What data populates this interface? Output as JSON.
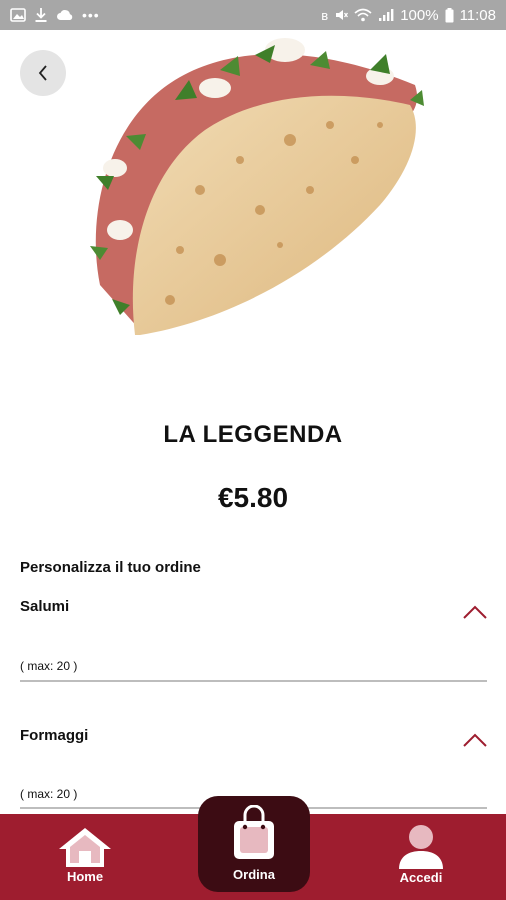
{
  "status_bar": {
    "battery_text": "100%",
    "time": "11:08",
    "dots": "•••",
    "bluetooth_glyph": "ʙ",
    "mute_glyph": "✕"
  },
  "product": {
    "name": "LA LEGGENDA",
    "price": "€5.80"
  },
  "customize": {
    "title": "Personalizza il tuo ordine",
    "sections": [
      {
        "title": "Salumi",
        "max_label": "( max: 20 )"
      },
      {
        "title": "Formaggi",
        "max_label": "( max: 20 )"
      }
    ]
  },
  "bottom_nav": {
    "home_label": "Home",
    "order_label": "Ordina",
    "account_label": "Accedi"
  },
  "colors": {
    "brand": "#9e1d2f",
    "brand_dark": "#3c0c13",
    "chevron": "#9e1d2f"
  }
}
